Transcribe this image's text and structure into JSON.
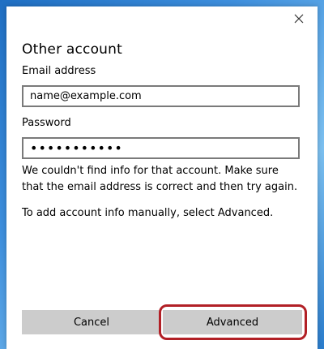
{
  "dialog": {
    "title": "Other account",
    "email": {
      "label": "Email address",
      "value": "name@example.com"
    },
    "password": {
      "label": "Password",
      "value": "•••••••••••"
    },
    "error_message": "We couldn't find info for that account. Make sure that the email address is correct and then try again.",
    "info_message": "To add account info manually, select Advanced.",
    "buttons": {
      "cancel": "Cancel",
      "advanced": "Advanced"
    }
  },
  "colors": {
    "highlight": "#b22026",
    "button_bg": "#cccccc",
    "field_border": "#7a7a7a"
  },
  "icons": {
    "close": "close-icon"
  }
}
